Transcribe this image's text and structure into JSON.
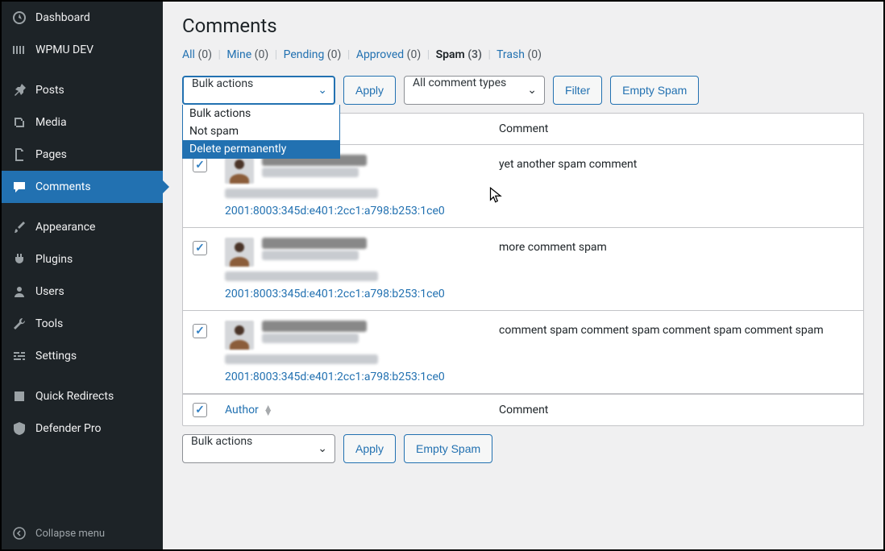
{
  "sidebar": {
    "items": [
      {
        "label": "Dashboard",
        "icon": "dashboard"
      },
      {
        "label": "WPMU DEV",
        "icon": "wpmu"
      },
      {
        "label": "Posts",
        "icon": "pin"
      },
      {
        "label": "Media",
        "icon": "media"
      },
      {
        "label": "Pages",
        "icon": "page"
      },
      {
        "label": "Comments",
        "icon": "comment",
        "current": true
      },
      {
        "label": "Appearance",
        "icon": "brush"
      },
      {
        "label": "Plugins",
        "icon": "plug"
      },
      {
        "label": "Users",
        "icon": "user"
      },
      {
        "label": "Tools",
        "icon": "wrench"
      },
      {
        "label": "Settings",
        "icon": "sliders"
      },
      {
        "label": "Quick Redirects",
        "icon": "redirect"
      },
      {
        "label": "Defender Pro",
        "icon": "shield"
      }
    ],
    "collapse": "Collapse menu"
  },
  "page": {
    "title": "Comments"
  },
  "filters": [
    {
      "label": "All",
      "count": "(0)"
    },
    {
      "label": "Mine",
      "count": "(0)"
    },
    {
      "label": "Pending",
      "count": "(0)"
    },
    {
      "label": "Approved",
      "count": "(0)"
    },
    {
      "label": "Spam",
      "count": "(3)",
      "current": true
    },
    {
      "label": "Trash",
      "count": "(0)"
    }
  ],
  "bulk": {
    "label": "Bulk actions",
    "options": [
      "Bulk actions",
      "Not spam",
      "Delete permanently"
    ],
    "apply": "Apply"
  },
  "comment_types": {
    "label": "All comment types"
  },
  "buttons": {
    "filter": "Filter",
    "empty_spam": "Empty Spam"
  },
  "table": {
    "headers": {
      "author": "Author",
      "comment": "Comment"
    },
    "rows": [
      {
        "ip": "2001:8003:345d:e401:2cc1:a798:b253:1ce0",
        "comment": "yet another spam comment",
        "checked": true
      },
      {
        "ip": "2001:8003:345d:e401:2cc1:a798:b253:1ce0",
        "comment": "more comment spam",
        "checked": true
      },
      {
        "ip": "2001:8003:345d:e401:2cc1:a798:b253:1ce0",
        "comment": "comment spam comment spam comment spam comment spam",
        "checked": true
      }
    ]
  }
}
